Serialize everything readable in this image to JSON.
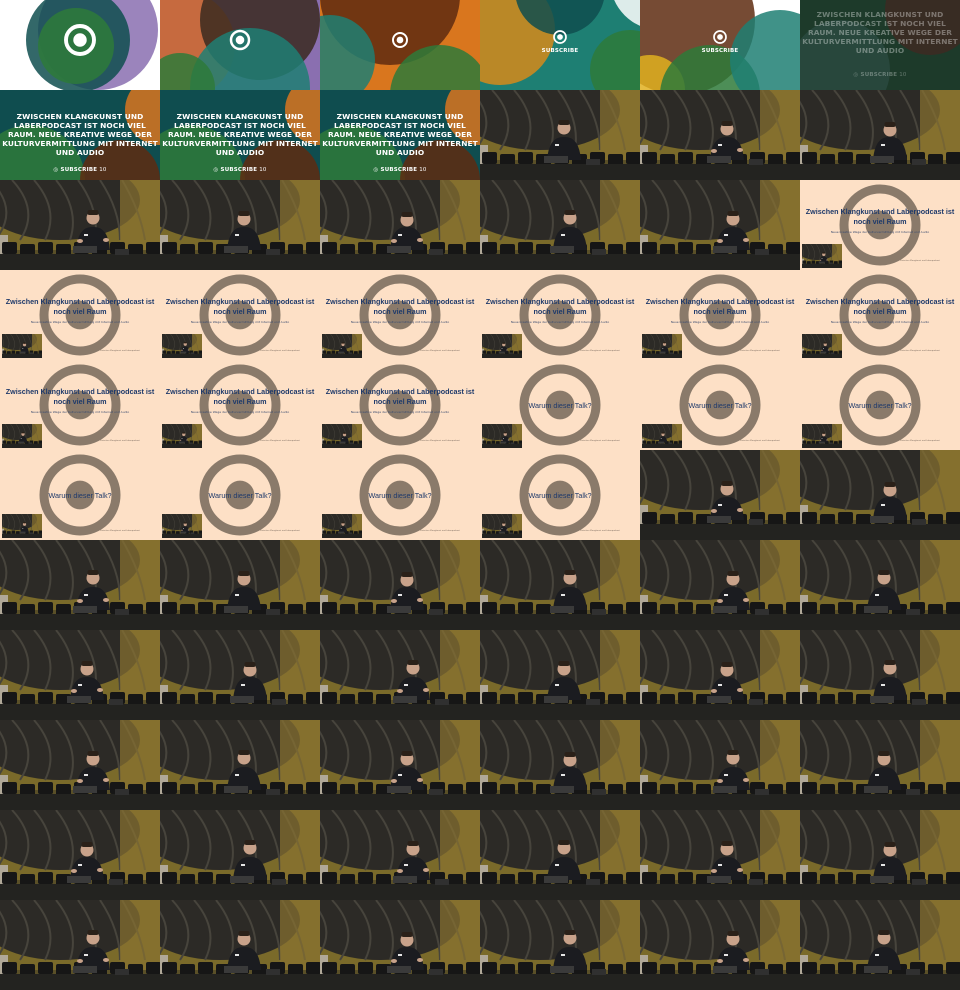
{
  "title_text": "ZWISCHEN KLANGKUNST UND LABERPODCAST IST NOCH VIEL RAUM. NEUE KREATIVE WEGE DER KULTURVERMITTLUNG MIT INTERNET UND AUDIO",
  "subscribe_label": "SUBSCRIBE",
  "subscribe_suffix": "10",
  "slide_title": "Zwischen Klangkunst und Laberpodcast ist noch viel Raum",
  "slide_subtitle": "Neue kreative Wege der Kulturvermittlung mit Internet und Audio",
  "slide_question": "Warum dieser Talk?",
  "slide_footer": "Zwischen Klangkunst und Laberpodcast",
  "colors": {
    "teal": "#1e7f73",
    "orange": "#d9761e",
    "purple": "#8a6fb0",
    "green": "#2e7a3a",
    "slide_bg": "#fde0c6",
    "slide_text": "#1f3a6b"
  },
  "tiles": [
    {
      "type": "intro-circle",
      "variant": 0
    },
    {
      "type": "intro-circle",
      "variant": 1
    },
    {
      "type": "intro-circle",
      "variant": 2
    },
    {
      "type": "intro-circle",
      "variant": 3,
      "subscribe": true
    },
    {
      "type": "intro-circle",
      "variant": 4,
      "subscribe": true
    },
    {
      "type": "intro-title",
      "variant": 5,
      "faded": true
    },
    {
      "type": "intro-title",
      "variant": 6
    },
    {
      "type": "intro-title",
      "variant": 7
    },
    {
      "type": "intro-title",
      "variant": 8
    },
    {
      "type": "camera",
      "pose": 0
    },
    {
      "type": "camera",
      "pose": 1
    },
    {
      "type": "camera",
      "pose": 2
    },
    {
      "type": "camera",
      "pose": 3
    },
    {
      "type": "camera",
      "pose": 4
    },
    {
      "type": "camera",
      "pose": 5
    },
    {
      "type": "camera",
      "pose": 6
    },
    {
      "type": "camera",
      "pose": 7
    },
    {
      "type": "slide-title",
      "cam_top": false,
      "footer": false
    },
    {
      "type": "slide-title"
    },
    {
      "type": "slide-title"
    },
    {
      "type": "slide-title"
    },
    {
      "type": "slide-title"
    },
    {
      "type": "slide-title"
    },
    {
      "type": "slide-title"
    },
    {
      "type": "slide-title"
    },
    {
      "type": "slide-title"
    },
    {
      "type": "slide-title"
    },
    {
      "type": "slide-question"
    },
    {
      "type": "slide-question"
    },
    {
      "type": "slide-question"
    },
    {
      "type": "slide-question"
    },
    {
      "type": "slide-question"
    },
    {
      "type": "slide-question"
    },
    {
      "type": "slide-question"
    },
    {
      "type": "camera",
      "pose": 1
    },
    {
      "type": "camera",
      "pose": 2
    },
    {
      "type": "camera",
      "pose": 3
    },
    {
      "type": "camera",
      "pose": 4
    },
    {
      "type": "camera",
      "pose": 5
    },
    {
      "type": "camera",
      "pose": 6
    },
    {
      "type": "camera",
      "pose": 7
    },
    {
      "type": "camera",
      "pose": 0
    },
    {
      "type": "camera",
      "pose": 1
    },
    {
      "type": "camera",
      "pose": 2
    },
    {
      "type": "camera",
      "pose": 3
    },
    {
      "type": "camera",
      "pose": 4
    },
    {
      "type": "camera",
      "pose": 5
    },
    {
      "type": "camera",
      "pose": 6
    },
    {
      "type": "camera",
      "pose": 7
    },
    {
      "type": "camera",
      "pose": 0
    },
    {
      "type": "camera",
      "pose": 1
    },
    {
      "type": "camera",
      "pose": 2
    },
    {
      "type": "camera",
      "pose": 3
    },
    {
      "type": "camera",
      "pose": 4
    },
    {
      "type": "camera",
      "pose": 5
    },
    {
      "type": "camera",
      "pose": 6
    },
    {
      "type": "camera",
      "pose": 7
    },
    {
      "type": "camera",
      "pose": 0
    },
    {
      "type": "camera",
      "pose": 1
    },
    {
      "type": "camera",
      "pose": 2
    },
    {
      "type": "camera",
      "pose": 3
    },
    {
      "type": "camera",
      "pose": 4
    },
    {
      "type": "camera",
      "pose": 5
    },
    {
      "type": "camera",
      "pose": 6
    },
    {
      "type": "camera",
      "pose": 7
    },
    {
      "type": "camera",
      "pose": 0
    }
  ]
}
